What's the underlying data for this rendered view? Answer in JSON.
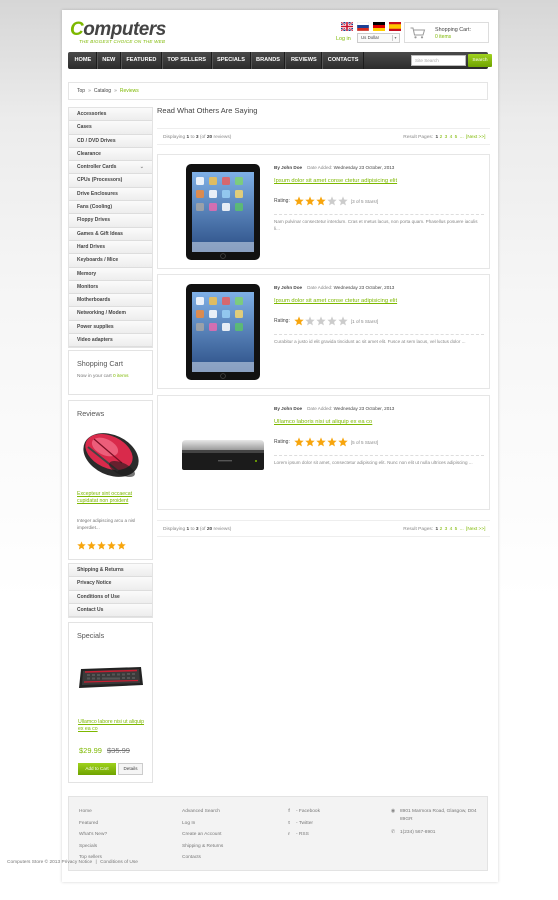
{
  "brand": {
    "logo_first_letter": "C",
    "logo_rest": "omputers",
    "tagline": "THE BIGGEST CHOICE ON THE WEB",
    "accent_color": "#7db800"
  },
  "header": {
    "languages": [
      "english-flag-icon",
      "russian-flag-icon",
      "german-flag-icon",
      "spanish-flag-icon"
    ],
    "login_label": "Log in",
    "currency": "Us Dollar",
    "cart_title": "Shopping Cart:",
    "cart_count": "0 items"
  },
  "nav": {
    "items": [
      "HOME",
      "NEW",
      "FEATURED",
      "TOP SELLERS",
      "SPECIALS",
      "BRANDS",
      "REVIEWS",
      "CONTACTS"
    ],
    "search_placeholder": "Site Search",
    "search_button": "Search"
  },
  "breadcrumb": {
    "items": [
      "Top",
      "Catalog",
      "Reviews"
    ],
    "separator": "»"
  },
  "sidebar": {
    "categories": [
      "Accessories",
      "Cases",
      "CD / DVD Drives",
      "Clearance",
      "Controller Cards",
      "CPUs (Processors)",
      "Drive Enclosures",
      "Fans (Cooling)",
      "Floppy Drives",
      "Games & Gift Ideas",
      "Hard Drives",
      "Keyboards / Mice",
      "Memory",
      "Monitors",
      "Motherboards",
      "Networking / Modem",
      "Power supplies",
      "Video adapters"
    ],
    "expand_arrow": "⌄",
    "shopping_cart": {
      "title": "Shopping Cart",
      "text": "Now in your cart",
      "count": "0 items"
    },
    "reviews": {
      "title": "Reviews",
      "link": "Excepteur sint occaecat cupidatat non proident",
      "text": "Integer adipiscing arcu a nisl imperdiet...",
      "rating": 5
    },
    "info_links": [
      "Shipping & Returns",
      "Privacy Notice",
      "Conditions of Use",
      "Contact Us"
    ],
    "specials": {
      "title": "Specials",
      "link": "Ullamco labore nisi ut aliquip ex ea co",
      "price": "$29.99",
      "old_price": "$35.99",
      "add_to_cart": "Add to Cart",
      "details": "Details"
    }
  },
  "main": {
    "title": "Read What Others Are Saying",
    "pager": {
      "displaying": "Displaying",
      "from": "1",
      "to_word": "to",
      "to": "3",
      "of_open": "(of",
      "total": "20",
      "of_close": "reviews)",
      "result_pages": "Result Pages:",
      "current": "1",
      "pages": [
        "2",
        "3",
        "4",
        "5"
      ],
      "ellipsis": "...",
      "next": "[Next >>]"
    },
    "reviews": [
      {
        "author": "By John Doe",
        "date_label": "Date Added:",
        "date": "Wednesday 23 October, 2013",
        "title": "Ipsum dolor sit amet conse ctetur adipisicing elit",
        "rating_label": "Rating:",
        "rating": 3,
        "rating_text": "[3 of 5 Stars!]",
        "text": "Nam pulvinar consectetur interdum. Cras et metus lacus, non porta quam. Phasellus posuere iaculis li..."
      },
      {
        "author": "By John Doe",
        "date_label": "Date Added:",
        "date": "Wednesday 23 October, 2013",
        "title": "Ipsum dolor sit amet conse ctetur adipisicing elit",
        "rating_label": "Rating:",
        "rating": 1,
        "rating_text": "[1 of 5 Stars!]",
        "text": "Curabitur a justo id elit gravida tincidunt ac sit amet elit. Fusce at sem lacus, vel luctus dolor ..."
      },
      {
        "author": "By John Doe",
        "date_label": "Date Added:",
        "date": "Wednesday 23 October, 2013",
        "title": "Ullamco laboris nisi ut aliquip ex ea co",
        "rating_label": "Rating:",
        "rating": 5,
        "rating_text": "[5 of 5 Stars!]",
        "text": "Lorem ipsum dolor sit amet, consectetur adipiscing elit. Nunc non elit ut nulla ultrices adipiscing ..."
      }
    ]
  },
  "footer": {
    "col1": [
      "Home",
      "Featured",
      "What's New?",
      "Specials",
      "Top sellers"
    ],
    "col2": [
      "Advanced Search",
      "Log In",
      "Create an Account",
      "Shipping & Returns",
      "Contacts"
    ],
    "social": [
      {
        "icon": "facebook-icon",
        "glyph": "f",
        "label": "- Facebook"
      },
      {
        "icon": "twitter-icon",
        "glyph": "t",
        "label": "- Twitter"
      },
      {
        "icon": "rss-icon",
        "glyph": "r",
        "label": "- RSS"
      }
    ],
    "address_icon": "location-icon",
    "address": "8901 Marmora Road, Glasgow, D04 89GR",
    "phone_icon": "phone-icon",
    "phone": "1(234) 567-8901",
    "copyright": "Computers Store",
    "copyright_year": "© 2013",
    "privacy": "Privacy Notice",
    "separator": "|",
    "conditions": "Conditions of Use"
  },
  "colors": {
    "star": "#f7a50d",
    "star_empty": "#cccccc",
    "nav_bg": "#333333"
  }
}
